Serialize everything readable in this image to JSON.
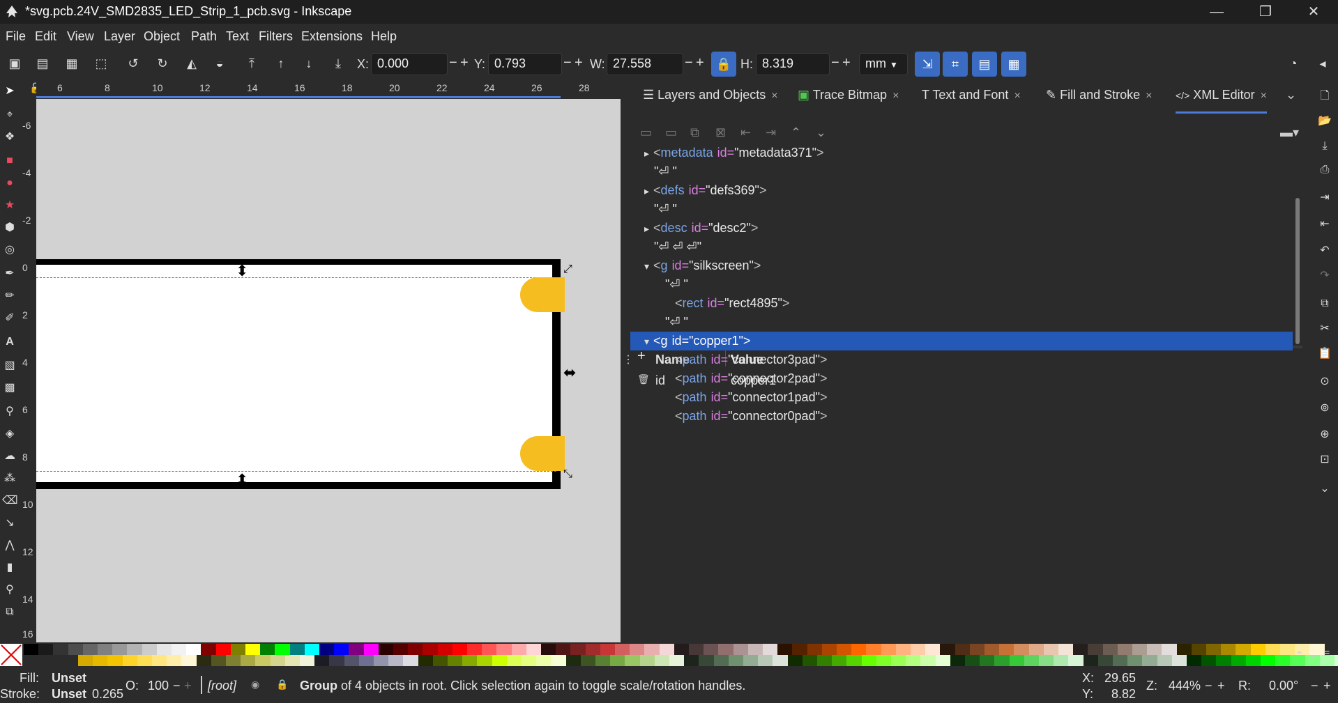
{
  "window": {
    "title": "*svg.pcb.24V_SMD2835_LED_Strip_1_pcb.svg - Inkscape",
    "controls": {
      "minimize": "—",
      "restore": "❐",
      "close": "✕"
    }
  },
  "menu": [
    "File",
    "Edit",
    "View",
    "Layer",
    "Object",
    "Path",
    "Text",
    "Filters",
    "Extensions",
    "Help"
  ],
  "tool_controls": {
    "x_label": "X:",
    "x_value": "0.000",
    "y_label": "Y:",
    "y_value": "0.793",
    "w_label": "W:",
    "w_value": "27.558",
    "h_label": "H:",
    "h_value": "8.319",
    "units": "mm",
    "minus": "−",
    "plus": "+",
    "lock_icon": "🔒"
  },
  "ruler_top_labels": [
    "6",
    "8",
    "10",
    "12",
    "14",
    "16",
    "18",
    "20",
    "22",
    "24",
    "26",
    "28"
  ],
  "ruler_left_labels": [
    "-6",
    "-4",
    "-2",
    "0",
    "2",
    "4",
    "6",
    "8",
    "10",
    "12",
    "14",
    "16"
  ],
  "handles": {
    "vertical": "⬍",
    "horizontal": "⬌",
    "diag_ne": "⤢",
    "diag_se": "⤡"
  },
  "tabs": [
    {
      "icon": "☰",
      "label": "Layers and Objects",
      "close": "×"
    },
    {
      "icon": "▣",
      "label": "Trace Bitmap",
      "close": "×"
    },
    {
      "icon": "T",
      "label": "Text and Font",
      "close": "×"
    },
    {
      "icon": "✎",
      "label": "Fill and Stroke",
      "close": "×"
    },
    {
      "icon": "</>",
      "label": "XML Editor",
      "close": "×"
    }
  ],
  "tabs_overflow": "⌄",
  "xml_nodes": [
    {
      "arrow": "▸",
      "open": "<",
      "tag": "metadata",
      "attr": "id=",
      "val": "\"metadata371\"",
      "close": ">",
      "indent": 0,
      "selected": false
    },
    {
      "text": "\"⏎ \"",
      "indent": 0,
      "selected": false
    },
    {
      "arrow": "▸",
      "open": "<",
      "tag": "defs",
      "attr": "id=",
      "val": "\"defs369\"",
      "close": ">",
      "indent": 0,
      "selected": false
    },
    {
      "text": "\"⏎ \"",
      "indent": 0,
      "selected": false
    },
    {
      "arrow": "▸",
      "open": "<",
      "tag": "desc",
      "attr": "id=",
      "val": "\"desc2\"",
      "close": ">",
      "indent": 0,
      "selected": false
    },
    {
      "text": "\"⏎ ⏎ ⏎\"",
      "indent": 0,
      "selected": false
    },
    {
      "arrow": "▾",
      "open": "<",
      "tag": "g",
      "attr": "id=",
      "val": "\"silkscreen\"",
      "close": ">",
      "indent": 0,
      "selected": false
    },
    {
      "text": "\"⏎  \"",
      "indent": 1,
      "selected": false
    },
    {
      "open": "<",
      "tag": "rect",
      "attr": "id=",
      "val": "\"rect4895\"",
      "close": ">",
      "indent": 1,
      "selected": false
    },
    {
      "text": "\"⏎ \"",
      "indent": 1,
      "selected": false
    },
    {
      "arrow": "▾",
      "open": "<",
      "tag": "g",
      "attr": "id=",
      "val": "\"copper1\"",
      "close": ">",
      "indent": 0,
      "selected": true
    },
    {
      "open": "<",
      "tag": "path",
      "attr": "id=",
      "val": "\"connector3pad\"",
      "close": ">",
      "indent": 1,
      "selected": false
    },
    {
      "open": "<",
      "tag": "path",
      "attr": "id=",
      "val": "\"connector2pad\"",
      "close": ">",
      "indent": 1,
      "selected": false
    },
    {
      "open": "<",
      "tag": "path",
      "attr": "id=",
      "val": "\"connector1pad\"",
      "close": ">",
      "indent": 1,
      "selected": false
    },
    {
      "open": "<",
      "tag": "path",
      "attr": "id=",
      "val": "\"connector0pad\"",
      "close": ">",
      "indent": 1,
      "selected": false
    }
  ],
  "attributes": {
    "add": "+",
    "name_header": "Name",
    "value_header": "Value",
    "rows": [
      {
        "delete": "🗑",
        "name": "id",
        "value": "copper1"
      }
    ]
  },
  "status": {
    "fill_label": "Fill:",
    "fill_value": "Unset",
    "stroke_label": "Stroke:",
    "stroke_value": "Unset",
    "stroke_width": "0.265",
    "opacity_label": "O:",
    "opacity_value": "100",
    "layer": "[root]",
    "message_bold": "Group",
    "message": " of 4 objects in root. Click selection again to toggle scale/rotation handles.",
    "cursor_x_label": "X:",
    "cursor_x": "29.65",
    "cursor_y_label": "Y:",
    "cursor_y": "8.82",
    "zoom_label": "Z:",
    "zoom": "444%",
    "rotation_label": "R:",
    "rotation": "0.00°"
  },
  "colors": {
    "accent": "#2559b8",
    "pad": "#f5bd1f",
    "palette_top": [
      "#000000",
      "#1a1a1a",
      "#333333",
      "#4d4d4d",
      "#666666",
      "#808080",
      "#999999",
      "#b3b3b3",
      "#cccccc",
      "#e6e6e6",
      "#f2f2f2",
      "#ffffff",
      "#800000",
      "#ff0000",
      "#808000",
      "#ffff00",
      "#008000",
      "#00ff00",
      "#008080",
      "#00ffff",
      "#000080",
      "#0000ff",
      "#800080",
      "#ff00ff",
      "#2b0000",
      "#550000",
      "#800000",
      "#aa0000",
      "#d40000",
      "#ff0000",
      "#ff2a2a",
      "#ff5555",
      "#ff8080",
      "#ffaaaa",
      "#ffd5d5",
      "#280b0b",
      "#501616",
      "#782121",
      "#a02c2c",
      "#c83737",
      "#d35f5f",
      "#de8787",
      "#e9afaf",
      "#f4d7d7",
      "#241c1c",
      "#483737",
      "#6c5353",
      "#916f6f",
      "#ac9393",
      "#c8b7b7",
      "#e3dbdb",
      "#2b1100",
      "#552200",
      "#803300",
      "#aa4400",
      "#d45500",
      "#ff6600",
      "#ff7f2a",
      "#ff9955",
      "#ffb380",
      "#ffccaa",
      "#ffe6d5",
      "#28170b",
      "#502d16",
      "#784421",
      "#a05a2c",
      "#c87137",
      "#d38d5f",
      "#deaa87",
      "#e9c6af",
      "#f4e3d7",
      "#241f1c",
      "#483e37",
      "#6c5d53",
      "#917c6f",
      "#ac9d93",
      "#c8beb7",
      "#e3dedb",
      "#2b2200",
      "#554400",
      "#806600",
      "#aa8800",
      "#d4aa00",
      "#ffcc00",
      "#ffdd55",
      "#ffe680",
      "#ffeeaa",
      "#fff6d5"
    ],
    "palette_bottom": [
      "#d4aa00",
      "#e6b800",
      "#f2c300",
      "#ffd42a",
      "#ffdd55",
      "#ffe680",
      "#ffeeaa",
      "#fff6d5",
      "#2b2b11",
      "#555522",
      "#808033",
      "#aaaa44",
      "#c8c864",
      "#d4d48c",
      "#e6e6b4",
      "#f2f2da",
      "#1c1c24",
      "#373748",
      "#53536c",
      "#6f6f91",
      "#9393ac",
      "#b7b7c8",
      "#dbdbe3",
      "#222b00",
      "#445500",
      "#668000",
      "#88aa00",
      "#aad400",
      "#ccff00",
      "#ddff55",
      "#e5ff80",
      "#eeffaa",
      "#f6ffd5",
      "#1e2b11",
      "#3c5522",
      "#5a8033",
      "#78aa44",
      "#98c864",
      "#b4d48c",
      "#cce6b4",
      "#e6f2da",
      "#1c241c",
      "#374837",
      "#536c53",
      "#6f916f",
      "#93ac93",
      "#b7c8b7",
      "#dbe3db",
      "#112b00",
      "#225500",
      "#338000",
      "#44aa00",
      "#55d400",
      "#66ff00",
      "#7fff2a",
      "#99ff55",
      "#b3ff80",
      "#ccffaa",
      "#e5ffd5",
      "#0b280b",
      "#165016",
      "#217821",
      "#2ca02c",
      "#37c837",
      "#5fd35f",
      "#87de87",
      "#afe9af",
      "#d7f4d7",
      "#1c241c",
      "#374837",
      "#536c53",
      "#6f916f",
      "#93ac93",
      "#b7c8b7",
      "#dbe3db",
      "#002b00",
      "#005500",
      "#008000",
      "#00aa00",
      "#00d400",
      "#00ff00",
      "#2aff2a",
      "#55ff55",
      "#80ff80",
      "#aaffaa",
      "#d5ffd5"
    ]
  }
}
